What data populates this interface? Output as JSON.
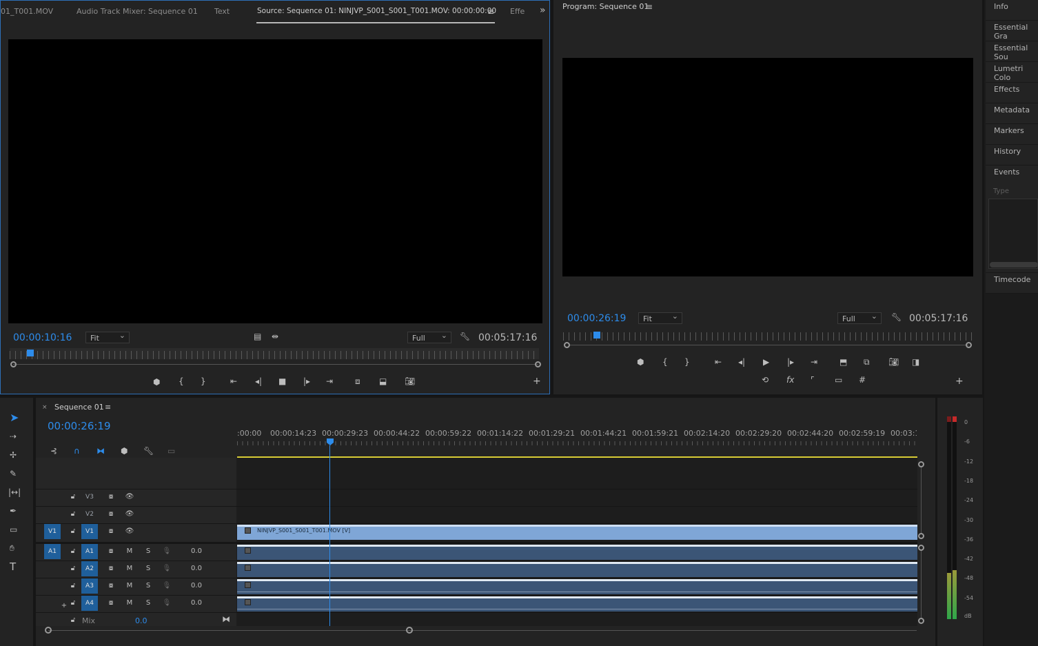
{
  "source_panel": {
    "tabs": [
      "01_T001.MOV",
      "Audio Track Mixer: Sequence 01",
      "Text",
      "Source: Sequence 01: NINJVP_S001_S001_T001.MOV: 00:00:00:00",
      "Effe"
    ],
    "timecode_current": "00:00:10:16",
    "zoom": "Fit",
    "resolution": "Full",
    "timecode_duration": "00:05:17:16",
    "playhead_fraction": 0.032
  },
  "program_panel": {
    "title": "Program: Sequence 01",
    "timecode_current": "00:00:26:19",
    "zoom": "Fit",
    "resolution": "Full",
    "timecode_duration": "00:05:17:16",
    "playhead_fraction": 0.074
  },
  "right_panel": {
    "items": [
      "Info",
      "Essential Gra",
      "Essential Sou",
      "Lumetri Colo",
      "Effects",
      "Metadata",
      "Markers",
      "History",
      "Events"
    ],
    "events_type_label": "Type",
    "timecode_label": "Timecode"
  },
  "timeline": {
    "tab_title": "Sequence 01",
    "timecode": "00:00:26:19",
    "ruler_labels": [
      ":00:00",
      "00:00:14:23",
      "00:00:29:23",
      "00:00:44:22",
      "00:00:59:22",
      "00:01:14:22",
      "00:01:29:21",
      "00:01:44:21",
      "00:01:59:21",
      "00:02:14:20",
      "00:02:29:20",
      "00:02:44:20",
      "00:02:59:19",
      "00:03:1"
    ],
    "video_tracks": [
      {
        "name": "V3",
        "source": ""
      },
      {
        "name": "V2",
        "source": ""
      },
      {
        "name": "V1",
        "source": "V1"
      }
    ],
    "audio_tracks": [
      {
        "name": "A1",
        "source": "A1",
        "m": "M",
        "s": "S",
        "vol": "0.0"
      },
      {
        "name": "A2",
        "source": "",
        "m": "M",
        "s": "S",
        "vol": "0.0"
      },
      {
        "name": "A3",
        "source": "",
        "m": "M",
        "s": "S",
        "vol": "0.0"
      },
      {
        "name": "A4",
        "source": "",
        "m": "M",
        "s": "S",
        "vol": "0.0"
      }
    ],
    "mix_label": "Mix",
    "mix_value": "0.0",
    "video_clip_label": "NINJVP_S001_S001_T001.MOV [V]"
  },
  "vu_meter": {
    "labels": [
      "0",
      "-6",
      "-12",
      "-18",
      "-24",
      "-30",
      "-36",
      "-42",
      "-48",
      "-54",
      "dB"
    ]
  },
  "colors": {
    "accent": "#2d8ceb",
    "video_clip": "#7fa6d6",
    "audio_clip": "#3b5576"
  }
}
